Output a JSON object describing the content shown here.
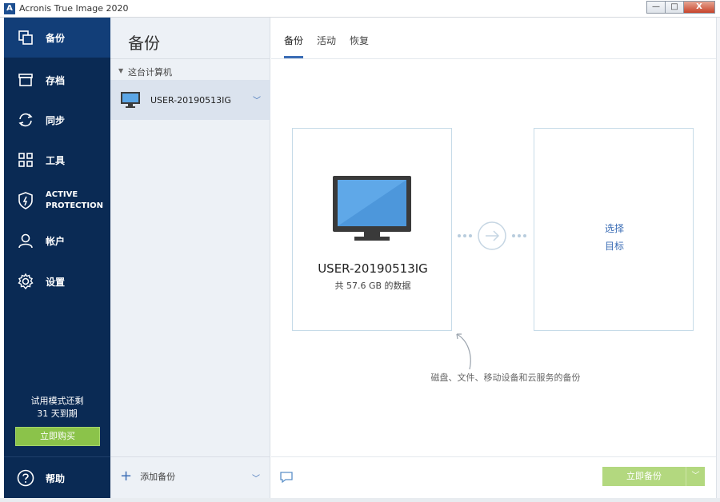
{
  "window": {
    "title": "Acronis True Image 2020",
    "logo_letter": "A",
    "minimize": "—",
    "maximize": "□",
    "close": "X"
  },
  "sidebar": {
    "items": [
      {
        "label": "备份",
        "icon": "backup-icon",
        "active": true
      },
      {
        "label": "存档",
        "icon": "archive-icon"
      },
      {
        "label": "同步",
        "icon": "sync-icon"
      },
      {
        "label": "工具",
        "icon": "tools-icon"
      },
      {
        "label_line1": "ACTIVE",
        "label_line2": "PROTECTION",
        "icon": "shield-icon"
      },
      {
        "label": "帐户",
        "icon": "account-icon"
      },
      {
        "label": "设置",
        "icon": "settings-icon"
      }
    ],
    "trial_line1": "试用模式还剩",
    "trial_line2": "31 天到期",
    "buy_label": "立即购买",
    "help_label": "帮助"
  },
  "middle": {
    "title": "备份",
    "group_label": "这台计算机",
    "backup_item": "USER-20190513IG",
    "add_backup": "添加备份"
  },
  "main": {
    "tabs": [
      {
        "label": "备份",
        "active": true
      },
      {
        "label": "活动"
      },
      {
        "label": "恢复"
      }
    ],
    "source_name": "USER-20190513IG",
    "source_size": "共 57.6 GB 的数据",
    "dest_line1": "选择",
    "dest_line2": "目标",
    "hint": "磁盘、文件、移动设备和云服务的备份",
    "backup_now": "立即备份"
  },
  "colors": {
    "sidebar_bg": "#0a2a54",
    "sidebar_active": "#123e78",
    "accent_blue": "#3b6db5",
    "buy_green": "#8bc34a",
    "backup_now_green": "#b3d87f"
  }
}
